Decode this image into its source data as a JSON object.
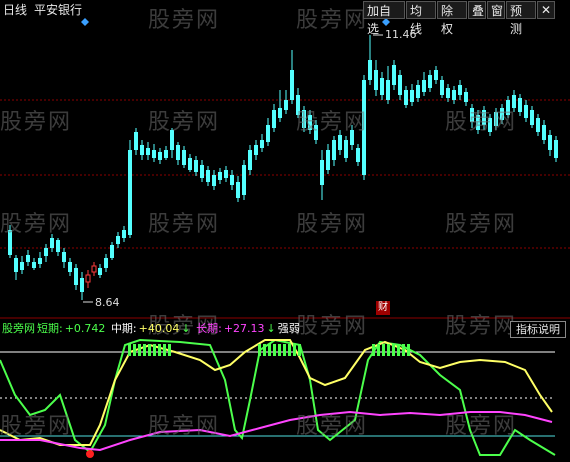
{
  "toolbar": {
    "period_label": "日线",
    "stock_name": "平安银行",
    "buttons": [
      "加自选",
      "均线",
      "除权",
      "叠",
      "窗",
      "预测"
    ],
    "close_glyph": "✕"
  },
  "price_labels": {
    "high": "11.46",
    "low": "8.64"
  },
  "finance_marker": "财",
  "indicator": {
    "name": "股旁网",
    "short_label": "短期:",
    "short_value": "+0.742",
    "mid_label": "中期:",
    "mid_value": "+40.04",
    "mid_arrow": "↓",
    "long_label": "长期:",
    "long_value": "+27.13",
    "long_arrow": "↓",
    "strong_label": "强弱",
    "explain_button": "指标说明"
  },
  "watermark_text": "股旁网",
  "colors": {
    "up": "#ff3b3b",
    "down": "#54ffff",
    "short_line": "#4cff4c",
    "mid_line": "#ffff66",
    "long_line": "#ff44ff",
    "grid": "#8b0000",
    "label_text": "#dddddd"
  },
  "icons": {
    "close": "close-icon",
    "diamond": "diamond-marker-icon",
    "arrow": "arrow-right-icon"
  }
}
